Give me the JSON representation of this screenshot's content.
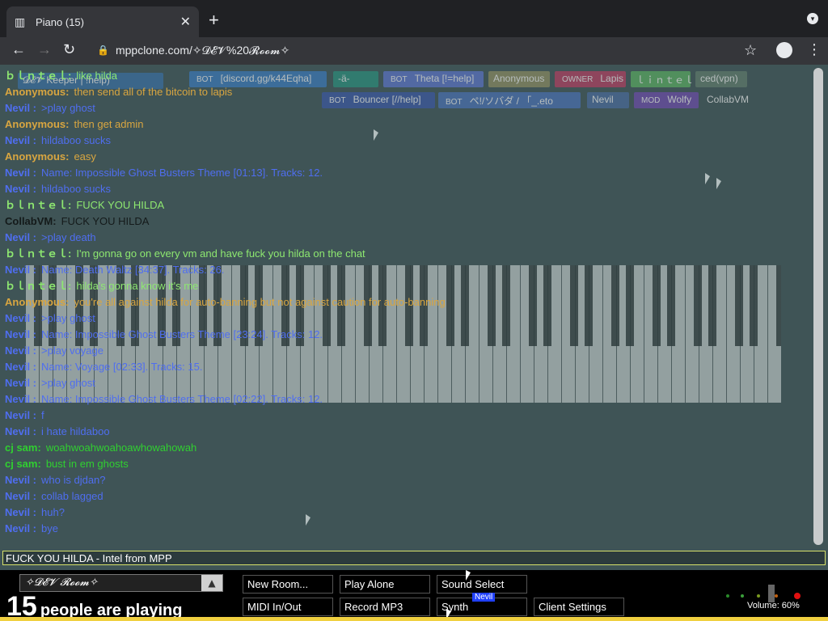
{
  "browser": {
    "tab_title": "Piano (15)",
    "url": "mppclone.com/✧𝓓𝓔𝓥%20𝓡𝓸𝓸𝓶✧"
  },
  "tags": [
    {
      "role": "",
      "name": "𝓓𝓔𝓥 Keeper | !help)",
      "color": "#3a6ea0"
    },
    {
      "role": "BOT",
      "name": "[discord.gg/k44Eqha]",
      "color": "#3b78b8"
    },
    {
      "role": "",
      "name": "-ä-",
      "color": "#2c8c7a"
    },
    {
      "role": "BOT",
      "name": "Theta [!=help]",
      "color": "#5b73c4"
    },
    {
      "role": "",
      "name": "Anonymous",
      "color": "#8a8a60"
    },
    {
      "role": "OWNER",
      "name": "Lapis",
      "color": "#b04060"
    },
    {
      "role": "",
      "name": "ｌｉｎｔｅｌ",
      "color": "#5aa860"
    },
    {
      "role": "",
      "name": "ced(vpn)",
      "color": "#5f7a6a"
    },
    {
      "role": "BOT",
      "name": "Bouncer [//help]",
      "color": "#3b58a0"
    },
    {
      "role": "BOT",
      "name": "ペ!/ソバダ / 「_.eto",
      "color": "#4a70b0"
    },
    {
      "role": "",
      "name": "Nevil",
      "color": "#4a6a9a"
    },
    {
      "role": "MOD",
      "name": "Wolfy",
      "color": "#6c4ca8"
    },
    {
      "role": "",
      "name": "CollabVM",
      "color": "#3f5456"
    }
  ],
  "chat": [
    {
      "nick": "ｂｌｎｔｅｌ:",
      "text": "like hilda",
      "color": "#8ee870"
    },
    {
      "nick": "Anonymous:",
      "text": "then send all of the bitcoin to lapis",
      "color": "#d9a640"
    },
    {
      "nick": "Nevil :",
      "text": ">play ghost",
      "color": "#4f6ef0"
    },
    {
      "nick": "Anonymous:",
      "text": "then get admin",
      "color": "#d9a640"
    },
    {
      "nick": "Nevil :",
      "text": "hildaboo sucks",
      "color": "#4f6ef0"
    },
    {
      "nick": "Anonymous:",
      "text": "easy",
      "color": "#d9a640"
    },
    {
      "nick": "Nevil :",
      "text": "Name: Impossible Ghost Busters Theme [01:13]. Tracks: 12.",
      "color": "#4f6ef0"
    },
    {
      "nick": "Nevil :",
      "text": "hildaboo sucks",
      "color": "#4f6ef0"
    },
    {
      "nick": "ｂｌｎｔｅｌ:",
      "text": "FUCK YOU HILDA",
      "color": "#8ee870"
    },
    {
      "nick": "CollabVM:",
      "text": "FUCK YOU HILDA",
      "color": "#141a1a"
    },
    {
      "nick": "Nevil :",
      "text": ">play death",
      "color": "#4f6ef0"
    },
    {
      "nick": "ｂｌｎｔｅｌ:",
      "text": "I'm gonna go on every vm and have fuck you hilda on the chat",
      "color": "#8ee870"
    },
    {
      "nick": "Nevil :",
      "text": "Name: Death Waltz [34:37]. Tracks: 26.",
      "color": "#4f6ef0"
    },
    {
      "nick": "ｂｌｎｔｅｌ:",
      "text": "hilda's gonna know it's me",
      "color": "#8ee870"
    },
    {
      "nick": "Anonymous:",
      "text": "you're all against hilda for auto-banning but not against caution for auto-banning",
      "color": "#d9a640"
    },
    {
      "nick": "Nevil :",
      "text": ">play ghost",
      "color": "#4f6ef0"
    },
    {
      "nick": "Nevil :",
      "text": "Name: Impossible Ghost Busters Theme [23:24]. Tracks: 12.",
      "color": "#4f6ef0"
    },
    {
      "nick": "Nevil :",
      "text": ">play voyage",
      "color": "#4f6ef0"
    },
    {
      "nick": "Nevil :",
      "text": "Name: Voyage [02:33]. Tracks: 15.",
      "color": "#4f6ef0"
    },
    {
      "nick": "Nevil :",
      "text": ">play ghost",
      "color": "#4f6ef0"
    },
    {
      "nick": "Nevil :",
      "text": "Name: Impossible Ghost Busters Theme [02:22]. Tracks: 12.",
      "color": "#4f6ef0"
    },
    {
      "nick": "Nevil :",
      "text": "f",
      "color": "#4f6ef0"
    },
    {
      "nick": "Nevil :",
      "text": "i hate hildaboo",
      "color": "#4f6ef0"
    },
    {
      "nick": "cj sam:",
      "text": "woahwoahwoahoawhowahowah",
      "color": "#30d030"
    },
    {
      "nick": "cj sam:",
      "text": "bust in em ghosts",
      "color": "#30d030"
    },
    {
      "nick": "Nevil :",
      "text": "who is djdan?",
      "color": "#4f6ef0"
    },
    {
      "nick": "Nevil :",
      "text": "collab lagged",
      "color": "#4f6ef0"
    },
    {
      "nick": "Nevil :",
      "text": "huh?",
      "color": "#4f6ef0"
    },
    {
      "nick": "Nevil :",
      "text": "bye",
      "color": "#4f6ef0"
    }
  ],
  "chat_input": "FUCK YOU HILDA - Intel from MPP",
  "bottom": {
    "room_name": "✧𝓓𝓔𝓥 𝓡𝓸𝓸𝓶✧",
    "people_count": "15",
    "people_label": "people are playing",
    "buttons": {
      "new_room": "New Room...",
      "play_alone": "Play Alone",
      "sound_select": "Sound Select",
      "midi": "MIDI In/Out",
      "record": "Record MP3",
      "synth": "Synth",
      "client_settings": "Client Settings"
    },
    "cursor_label": "Nevil",
    "volume": "Volume: 60%"
  }
}
